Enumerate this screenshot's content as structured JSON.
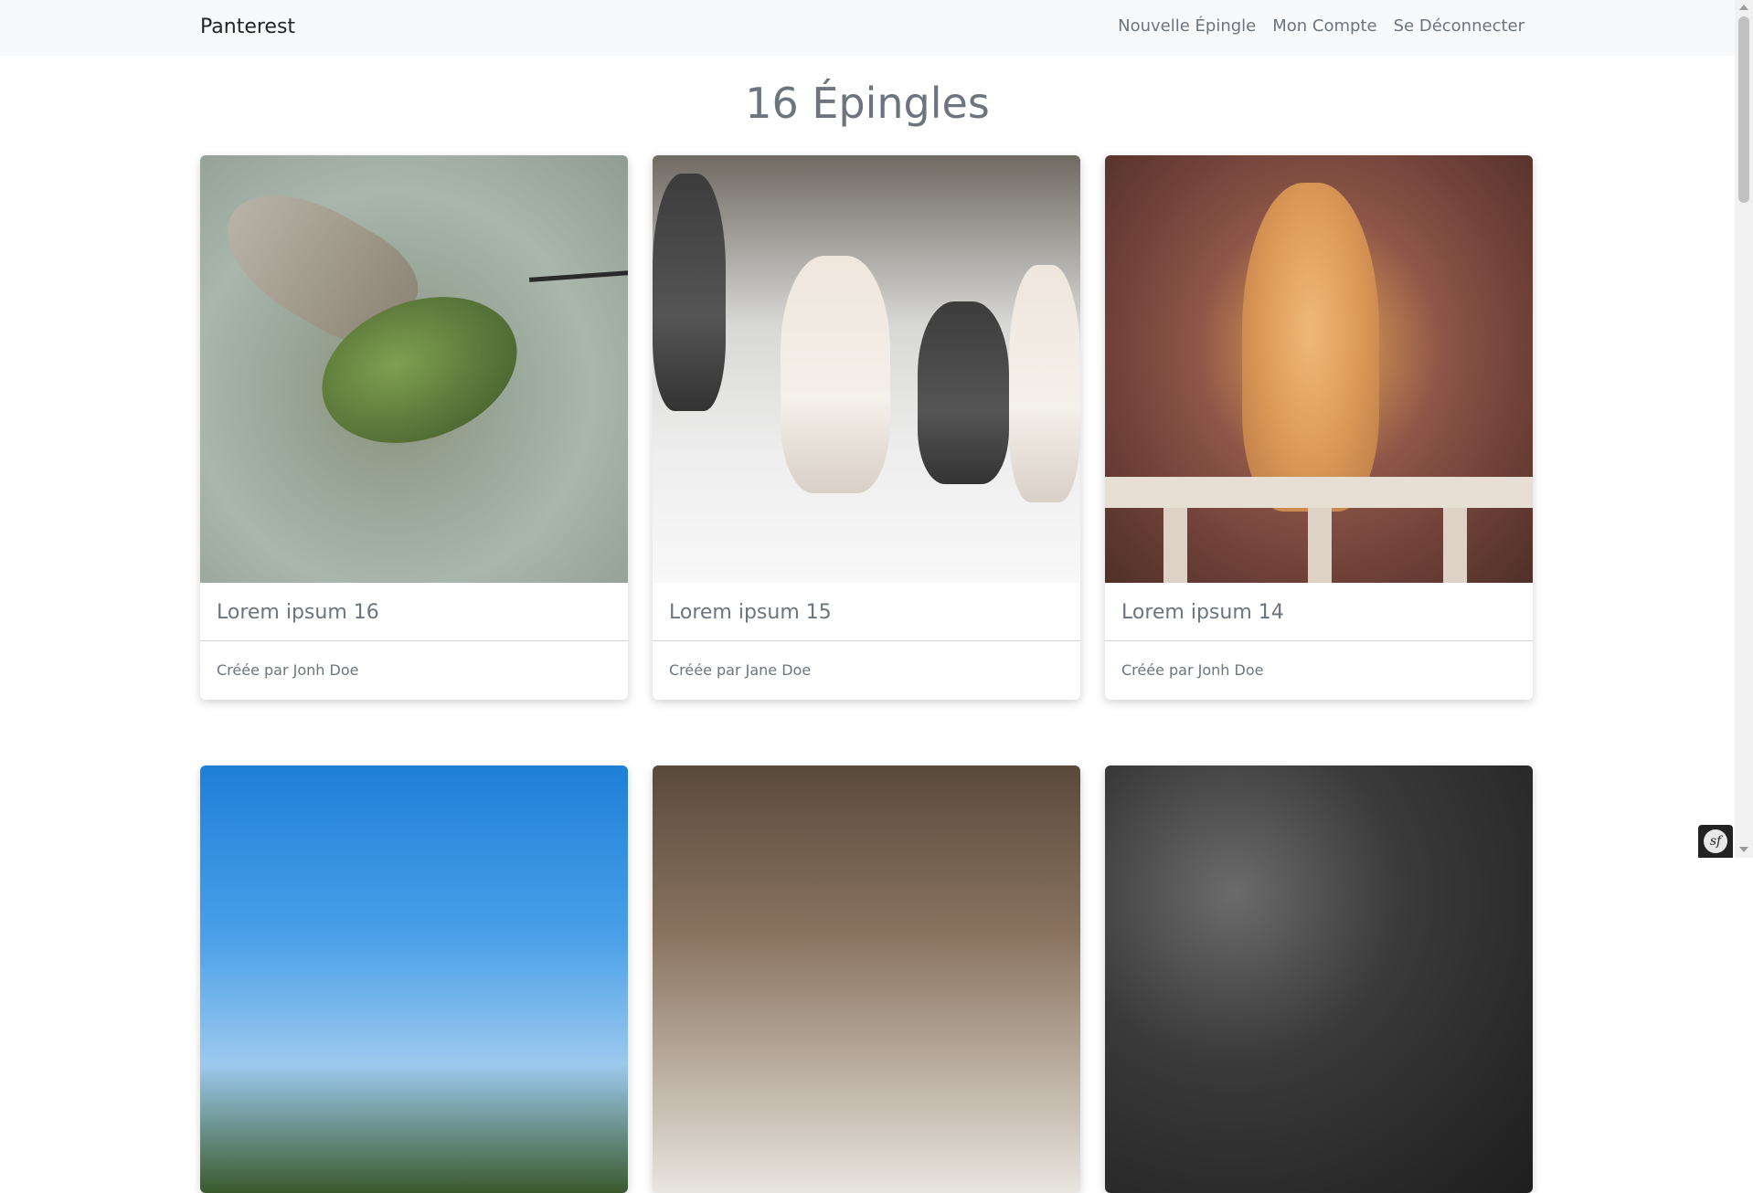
{
  "navbar": {
    "brand": "Panterest",
    "links": [
      "Nouvelle Épingle",
      "Mon Compte",
      "Se Déconnecter"
    ]
  },
  "main": {
    "title": "16 Épingles",
    "pins": [
      {
        "title": "Lorem ipsum 16",
        "author": "Créée par Jonh Doe",
        "image": "hummingbird-photo"
      },
      {
        "title": "Lorem ipsum 15",
        "author": "Créée par Jane Doe",
        "image": "sled-dogs-photo"
      },
      {
        "title": "Lorem ipsum 14",
        "author": "Créée par Jonh Doe",
        "image": "orange-cat-photo"
      },
      {
        "image": "blue-sky-mountain-photo"
      },
      {
        "image": "forest-animal-photo"
      },
      {
        "image": "dark-animal-photo"
      }
    ]
  },
  "debug_toolbar": {
    "icon": "symfony-icon",
    "glyph": "sf"
  }
}
